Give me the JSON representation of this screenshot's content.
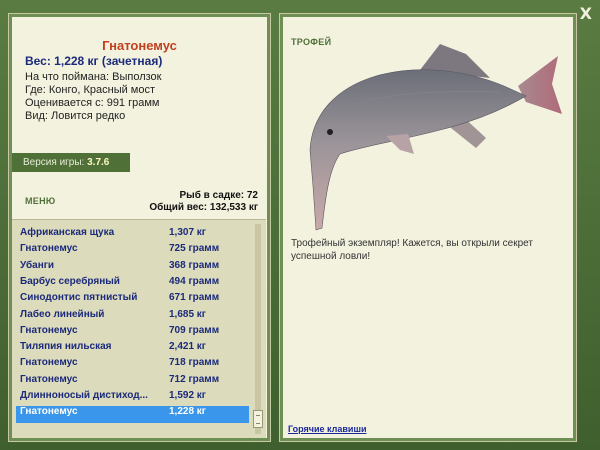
{
  "window": {
    "close_label": "X"
  },
  "catch": {
    "fish_name": "Гнатонемус",
    "weight_line": "Вес: 1,228 кг (зачетная)",
    "bait_line": "На что поймана: Выползок",
    "place_line": "Где: Конго, Красный мост",
    "value_line": "Оценивается с: 991 грамм",
    "kind_line": "Вид: Ловится редко"
  },
  "version": {
    "label": "Версия игры:",
    "number": "3.7.6"
  },
  "menu": {
    "label": "МЕНЮ"
  },
  "stats": {
    "fish_count": "Рыб в садке: 72",
    "total_weight": "Общий вес: 132,533 кг"
  },
  "fish_list": [
    {
      "name": "Африканская щука",
      "weight": "1,307 кг"
    },
    {
      "name": "Гнатонемус",
      "weight": "725 грамм"
    },
    {
      "name": "Убанги",
      "weight": "368 грамм"
    },
    {
      "name": "Барбус серебряный",
      "weight": "494 грамм"
    },
    {
      "name": "Синодонтис пятнистый",
      "weight": "671 грамм"
    },
    {
      "name": "Лабео линейный",
      "weight": "1,685 кг"
    },
    {
      "name": "Гнатонемус",
      "weight": "709 грамм"
    },
    {
      "name": "Тиляпия нильская",
      "weight": "2,421 кг"
    },
    {
      "name": "Гнатонемус",
      "weight": "718 грамм"
    },
    {
      "name": "Гнатонемус",
      "weight": "712 грамм"
    },
    {
      "name": "Длинноносый дистиход...",
      "weight": "1,592 кг"
    },
    {
      "name": "Гнатонемус",
      "weight": "1,228 кг"
    }
  ],
  "selected_index": 11,
  "trophy": {
    "label": "ТРОФЕЙ",
    "description": "Трофейный экземпляр! Кажется, вы открыли секрет успешной ловли!"
  },
  "hotkeys": {
    "label": "Горячие клавиши"
  },
  "colors": {
    "accent": "#4f7137",
    "selection": "#3a96ea",
    "title": "#c0401f",
    "list_text": "#1b2a7a"
  },
  "icons": {
    "close": "close-icon",
    "fish": "fish-illustration"
  }
}
